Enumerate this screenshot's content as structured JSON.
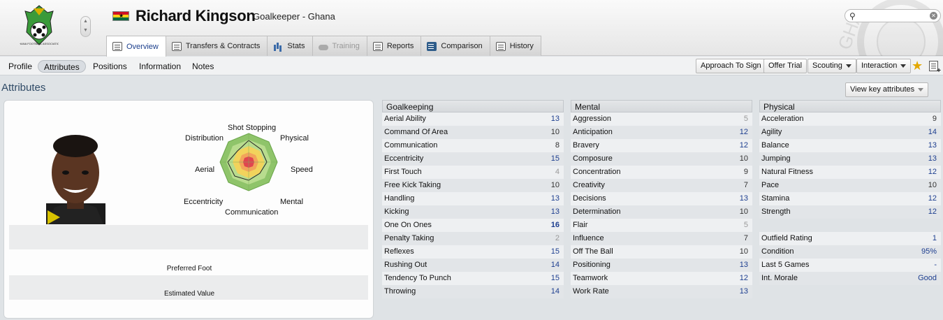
{
  "header": {
    "player_name": "Richard Kingson",
    "player_role": "Goalkeeper - Ghana",
    "crest_icon": "ghana-fa-crest",
    "flag_icon": "ghana-flag",
    "search": {
      "value": "",
      "placeholder": ""
    }
  },
  "tabs": [
    {
      "label": "Overview",
      "icon": "overview-icon",
      "active": true
    },
    {
      "label": "Transfers & Contracts",
      "icon": "document-icon"
    },
    {
      "label": "Stats",
      "icon": "bar-chart-icon"
    },
    {
      "label": "Training",
      "icon": "cloud-icon",
      "disabled": true
    },
    {
      "label": "Reports",
      "icon": "report-icon"
    },
    {
      "label": "Comparison",
      "icon": "comparison-icon"
    },
    {
      "label": "History",
      "icon": "history-icon"
    }
  ],
  "subnav": {
    "items": [
      "Profile",
      "Attributes",
      "Positions",
      "Information",
      "Notes"
    ],
    "active": "Attributes"
  },
  "actions": {
    "approach": "Approach To Sign",
    "offer_trial": "Offer Trial",
    "scouting": "Scouting",
    "interaction": "Interaction"
  },
  "section": {
    "title": "Attributes",
    "view_key": "View key attributes"
  },
  "radar_labels": {
    "top": "Shot Stopping",
    "top_left": "Distribution",
    "top_right": "Physical",
    "left": "Aerial",
    "right": "Speed",
    "bottom_left": "Eccentricity",
    "bottom_right": "Mental",
    "bottom": "Communication"
  },
  "profile_fields": {
    "preferred_foot": "Preferred Foot",
    "estimated_value": "Estimated Value"
  },
  "goalkeeping": {
    "title": "Goalkeeping",
    "rows": [
      {
        "name": "Aerial Ability",
        "value": "13"
      },
      {
        "name": "Command Of Area",
        "value": "10"
      },
      {
        "name": "Communication",
        "value": "8"
      },
      {
        "name": "Eccentricity",
        "value": "15"
      },
      {
        "name": "First Touch",
        "value": "4"
      },
      {
        "name": "Free Kick Taking",
        "value": "10"
      },
      {
        "name": "Handling",
        "value": "13"
      },
      {
        "name": "Kicking",
        "value": "13"
      },
      {
        "name": "One On Ones",
        "value": "16"
      },
      {
        "name": "Penalty Taking",
        "value": "2"
      },
      {
        "name": "Reflexes",
        "value": "15"
      },
      {
        "name": "Rushing Out",
        "value": "14"
      },
      {
        "name": "Tendency To Punch",
        "value": "15"
      },
      {
        "name": "Throwing",
        "value": "14"
      }
    ]
  },
  "mental": {
    "title": "Mental",
    "rows": [
      {
        "name": "Aggression",
        "value": "5"
      },
      {
        "name": "Anticipation",
        "value": "12"
      },
      {
        "name": "Bravery",
        "value": "12"
      },
      {
        "name": "Composure",
        "value": "10"
      },
      {
        "name": "Concentration",
        "value": "9"
      },
      {
        "name": "Creativity",
        "value": "7"
      },
      {
        "name": "Decisions",
        "value": "13"
      },
      {
        "name": "Determination",
        "value": "10"
      },
      {
        "name": "Flair",
        "value": "5"
      },
      {
        "name": "Influence",
        "value": "7"
      },
      {
        "name": "Off The Ball",
        "value": "10"
      },
      {
        "name": "Positioning",
        "value": "13"
      },
      {
        "name": "Teamwork",
        "value": "12"
      },
      {
        "name": "Work Rate",
        "value": "13"
      }
    ]
  },
  "physical": {
    "title": "Physical",
    "rows": [
      {
        "name": "Acceleration",
        "value": "9"
      },
      {
        "name": "Agility",
        "value": "14"
      },
      {
        "name": "Balance",
        "value": "13"
      },
      {
        "name": "Jumping",
        "value": "13"
      },
      {
        "name": "Natural Fitness",
        "value": "12"
      },
      {
        "name": "Pace",
        "value": "10"
      },
      {
        "name": "Stamina",
        "value": "12"
      },
      {
        "name": "Strength",
        "value": "12"
      }
    ],
    "extra": [
      {
        "name": "Outfield Rating",
        "value": "1"
      },
      {
        "name": "Condition",
        "value": "95%"
      },
      {
        "name": "Last 5 Games",
        "value": "-"
      },
      {
        "name": "Int. Morale",
        "value": "Good"
      }
    ]
  },
  "colors": {
    "accent": "#1d3e8f",
    "star": "#e3a800",
    "radar_outer": "#8fc46a",
    "radar_mid": "#f2d35c",
    "radar_inner": "#e0454f"
  }
}
